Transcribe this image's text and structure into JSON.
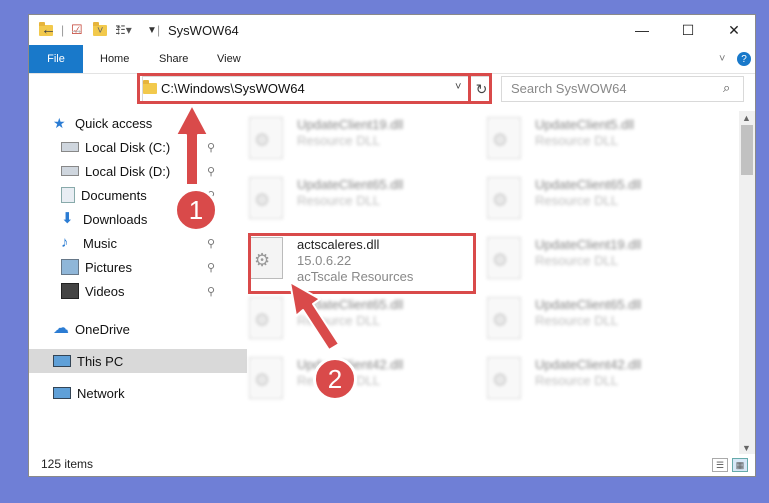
{
  "window": {
    "title": "SysWOW64",
    "minimize": "—",
    "maximize": "☐",
    "close": "✕"
  },
  "ribbon": {
    "tabs": [
      "File",
      "Home",
      "Share",
      "View"
    ],
    "help": "?",
    "expand": "˅"
  },
  "navigation": {
    "back": "←",
    "forward": "→",
    "recent": "˅",
    "up": "↑",
    "address": "C:\\Windows\\SysWOW64",
    "address_dropdown": "˅",
    "refresh": "↻",
    "search_placeholder": "Search SysWOW64",
    "search_icon": "⌕"
  },
  "sidebar": {
    "items": [
      {
        "label": "Quick access",
        "icon": "star-icon"
      },
      {
        "label": "Local Disk (C:)",
        "icon": "drive-icon"
      },
      {
        "label": "Local Disk (D:)",
        "icon": "drive-icon"
      },
      {
        "label": "Documents",
        "icon": "documents-icon"
      },
      {
        "label": "Downloads",
        "icon": "download-icon"
      },
      {
        "label": "Music",
        "icon": "music-icon"
      },
      {
        "label": "Pictures",
        "icon": "pictures-icon"
      },
      {
        "label": "Videos",
        "icon": "videos-icon"
      },
      {
        "label": "OneDrive",
        "icon": "cloud-icon"
      },
      {
        "label": "This PC",
        "icon": "computer-icon"
      },
      {
        "label": "Network",
        "icon": "network-icon"
      }
    ],
    "pin_glyph": "📌"
  },
  "files": [
    {
      "name": "UpdateClient19.dll",
      "sub": "Resource DLL"
    },
    {
      "name": "UpdateClient5.dll",
      "sub": "Resource DLL"
    },
    {
      "name": "UpdateClient65.dll",
      "sub": "Resource DLL"
    },
    {
      "name": "UpdateClient65.dll",
      "sub": "Resource DLL"
    },
    {
      "name": "actscaleres.dll",
      "sub": "15.0.6.22",
      "sub2": "acTscale Resources"
    },
    {
      "name": "UpdateClient19.dll",
      "sub": "Resource DLL"
    },
    {
      "name": "UpdateClient65.dll",
      "sub": "Resource DLL"
    },
    {
      "name": "UpdateClient65.dll",
      "sub": "Resource DLL"
    },
    {
      "name": "UpdateClient42.dll",
      "sub": "Resource DLL"
    },
    {
      "name": "UpdateClient42.dll",
      "sub": "Resource DLL"
    }
  ],
  "status": {
    "count": "125 items"
  },
  "annotations": {
    "step1": "1",
    "step2": "2",
    "color": "#d94a4a"
  }
}
